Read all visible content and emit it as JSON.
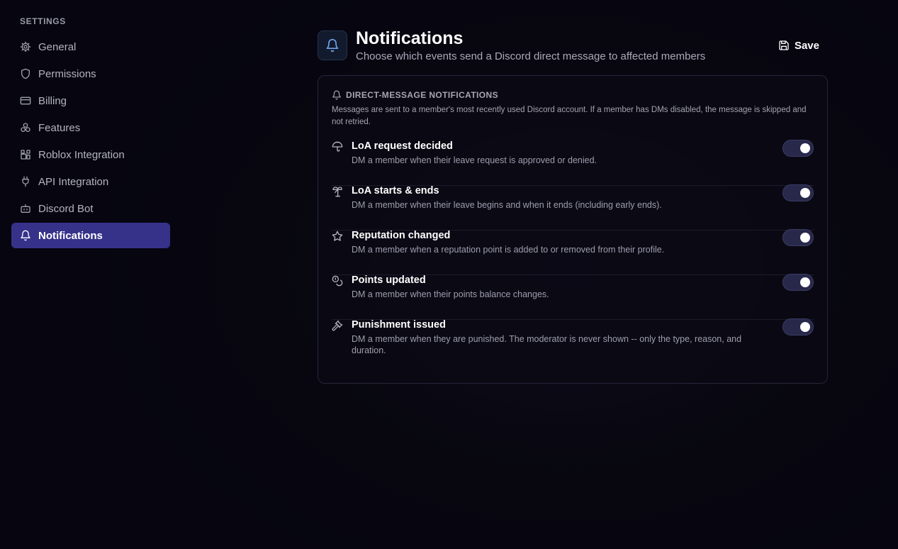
{
  "sidebar": {
    "heading": "SETTINGS",
    "items": [
      {
        "label": "General",
        "icon": "gear-icon"
      },
      {
        "label": "Permissions",
        "icon": "shield-icon"
      },
      {
        "label": "Billing",
        "icon": "credit-card-icon"
      },
      {
        "label": "Features",
        "icon": "features-icon"
      },
      {
        "label": "Roblox Integration",
        "icon": "blocks-icon"
      },
      {
        "label": "API Integration",
        "icon": "plug-icon"
      },
      {
        "label": "Discord Bot",
        "icon": "bot-icon"
      },
      {
        "label": "Notifications",
        "icon": "bell-icon",
        "active": true
      }
    ]
  },
  "header": {
    "icon": "bell-icon",
    "title": "Notifications",
    "subtitle": "Choose which events send a Discord direct message to affected members",
    "save_label": "Save"
  },
  "card": {
    "heading": "DIRECT-MESSAGE NOTIFICATIONS",
    "description": "Messages are sent to a member's most recently used Discord account. If a member has DMs disabled, the message is skipped and not retried.",
    "rows": [
      {
        "icon": "umbrella-icon",
        "title": "LoA request decided",
        "desc": "DM a member when their leave request is approved or denied.",
        "enabled": true
      },
      {
        "icon": "palm-tree-icon",
        "title": "LoA starts & ends",
        "desc": "DM a member when their leave begins and when it ends (including early ends).",
        "enabled": true
      },
      {
        "icon": "star-icon",
        "title": "Reputation changed",
        "desc": "DM a member when a reputation point is added to or removed from their profile.",
        "enabled": true
      },
      {
        "icon": "coins-icon",
        "title": "Points updated",
        "desc": "DM a member when their points balance changes.",
        "enabled": true
      },
      {
        "icon": "gavel-icon",
        "title": "Punishment issued",
        "desc": "DM a member when they are punished. The moderator is never shown -- only the type, reason, and duration.",
        "enabled": true
      }
    ]
  },
  "colors": {
    "accent_active": "#36328a",
    "background": "#07060e",
    "header_icon": "#6fa2e8"
  }
}
